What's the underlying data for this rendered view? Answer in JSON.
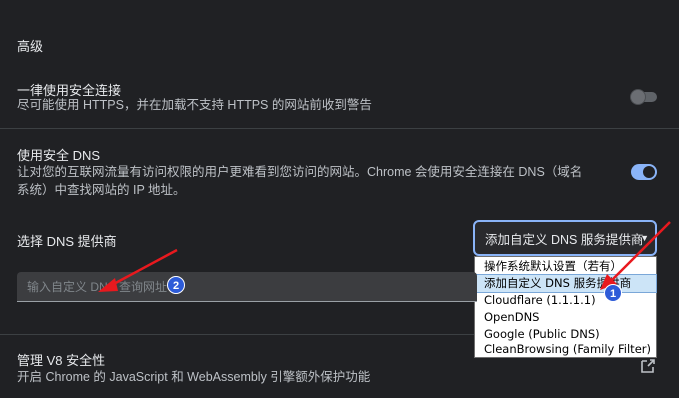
{
  "section": {
    "title": "高级"
  },
  "secure_connection": {
    "title": "一律使用安全连接",
    "description": "尽可能使用 HTTPS，并在加载不支持 HTTPS 的网站前收到警告",
    "enabled": false
  },
  "secure_dns": {
    "title": "使用安全 DNS",
    "description_line1": "让对您的互联网流量有访问权限的用户更难看到您访问的网站。Chrome 会使用安全连接在 DNS（域名",
    "description_line2": "系统）中查找网站的 IP 地址。",
    "enabled": true,
    "provider_label": "选择 DNS 提供商",
    "selected_provider": "添加自定义 DNS 服务提供商",
    "options": [
      "操作系统默认设置（若有）",
      "添加自定义 DNS 服务提供商",
      "Cloudflare (1.1.1.1)",
      "OpenDNS",
      "Google (Public DNS)",
      "CleanBrowsing (Family Filter)"
    ],
    "custom_input_placeholder": "输入自定义 DNS 查询网址"
  },
  "v8": {
    "title": "管理 V8 安全性",
    "description": "开启 Chrome 的 JavaScript 和 WebAssembly 引擎额外保护功能"
  },
  "annotations": {
    "badge1": "1",
    "badge2": "2"
  },
  "colors": {
    "accent": "#8ab4f8",
    "background": "#202124",
    "arrow": "#e8191e",
    "badge": "#2d5bd8"
  },
  "icons": {
    "external": "open-in-new-icon",
    "dropdown": "chevron-down-icon"
  }
}
